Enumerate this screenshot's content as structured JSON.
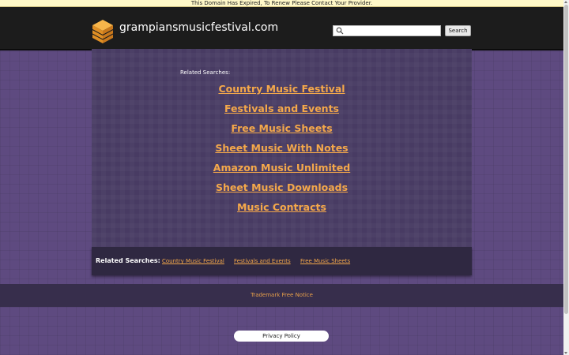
{
  "notice": "This Domain Has Expired, To Renew Please Contact Your Provider.",
  "header": {
    "site_title": "grampiansmusicfestival.com",
    "search_placeholder": "",
    "search_button": "Search"
  },
  "main": {
    "related_heading": "Related Searches:",
    "links": [
      "Country Music Festival",
      "Festivals and Events",
      "Free Music Sheets",
      "Sheet Music With Notes",
      "Amazon Music Unlimited",
      "Sheet Music Downloads",
      "Music Contracts"
    ]
  },
  "bottom_bar": {
    "heading": "Related Searches:",
    "links": [
      "Country Music Festival",
      "Festivals and Events",
      "Free Music Sheets"
    ]
  },
  "footer": {
    "trademark": "Trademark Free Notice",
    "privacy": "Privacy Policy"
  },
  "colors": {
    "link": "#f4a84a",
    "background": "#5e4a80",
    "header": "#1c1c1c",
    "notice": "#fff8c8"
  }
}
